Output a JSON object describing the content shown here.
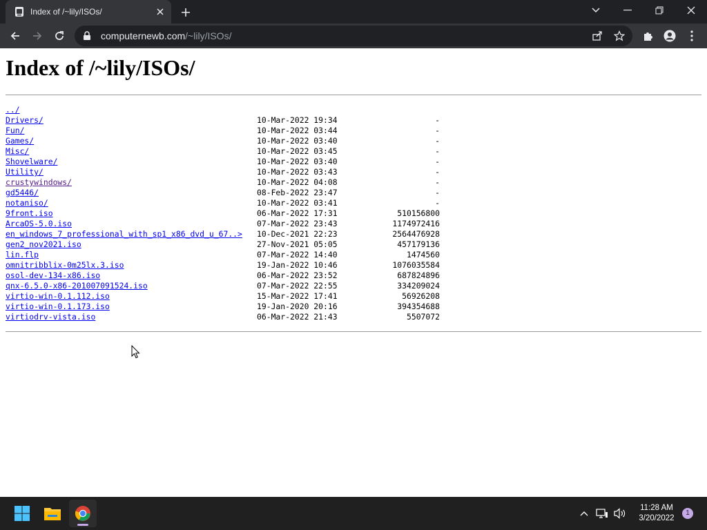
{
  "browser": {
    "tab_title": "Index of /~lily/ISOs/",
    "url_host": "computernewb.com",
    "url_path": "/~lily/ISOs/"
  },
  "icons": {
    "tab_favicon": "site-icon",
    "tab_close": "close-icon",
    "new_tab": "plus-icon",
    "back": "back-arrow-icon",
    "forward": "forward-arrow-icon",
    "reload": "reload-icon",
    "lock": "lock-icon",
    "share": "share-icon",
    "bookmark": "star-icon",
    "extensions": "puzzle-icon",
    "profile": "person-icon",
    "menu": "kebab-menu-icon"
  },
  "page": {
    "heading": "Index of /~lily/ISOs/",
    "entries": [
      {
        "name": "../",
        "date": "",
        "size": ""
      },
      {
        "name": "Drivers/",
        "date": "10-Mar-2022 19:34",
        "size": "-"
      },
      {
        "name": "Fun/",
        "date": "10-Mar-2022 03:44",
        "size": "-"
      },
      {
        "name": "Games/",
        "date": "10-Mar-2022 03:40",
        "size": "-"
      },
      {
        "name": "Misc/",
        "date": "10-Mar-2022 03:45",
        "size": "-"
      },
      {
        "name": "Shovelware/",
        "date": "10-Mar-2022 03:40",
        "size": "-"
      },
      {
        "name": "Utility/",
        "date": "10-Mar-2022 03:43",
        "size": "-"
      },
      {
        "name": "crustywindows/",
        "date": "10-Mar-2022 04:08",
        "size": "-"
      },
      {
        "name": "gd5446/",
        "date": "08-Feb-2022 23:47",
        "size": "-"
      },
      {
        "name": "notaniso/",
        "date": "10-Mar-2022 03:41",
        "size": "-"
      },
      {
        "name": "9front.iso",
        "date": "06-Mar-2022 17:31",
        "size": "510156800"
      },
      {
        "name": "ArcaOS-5.0.iso",
        "date": "07-Mar-2022 23:43",
        "size": "1174972416"
      },
      {
        "name": "en_windows_7_professional_with_sp1_x86_dvd_u_67..>",
        "date": "10-Dec-2021 22:23",
        "size": "2564476928"
      },
      {
        "name": "gen2_nov2021.iso",
        "date": "27-Nov-2021 05:05",
        "size": "457179136"
      },
      {
        "name": "lin.flp",
        "date": "07-Mar-2022 14:40",
        "size": "1474560"
      },
      {
        "name": "omnitribblix-0m25lx.3.iso",
        "date": "19-Jan-2022 10:46",
        "size": "1076035584"
      },
      {
        "name": "osol-dev-134-x86.iso",
        "date": "06-Mar-2022 23:52",
        "size": "687824896"
      },
      {
        "name": "qnx-6.5.0-x86-201007091524.iso",
        "date": "07-Mar-2022 22:55",
        "size": "334209024"
      },
      {
        "name": "virtio-win-0.1.112.iso",
        "date": "15-Mar-2022 17:41",
        "size": "56926208"
      },
      {
        "name": "virtio-win-0.1.173.iso",
        "date": "19-Jan-2020 20:16",
        "size": "394354688"
      },
      {
        "name": "virtiodrv-vista.iso",
        "date": "06-Mar-2022 21:43",
        "size": "5507072"
      }
    ]
  },
  "taskbar": {
    "apps": [
      "windows-start-icon",
      "file-explorer-icon",
      "chrome-icon"
    ],
    "time": "11:28 AM",
    "date": "3/20/2022",
    "notification_count": "1"
  },
  "colors": {
    "link": "#0000ee",
    "visited_link": "#551a8b",
    "chrome_dark": "#202124",
    "chrome_toolbar": "#35363a",
    "taskbar": "#202020"
  }
}
